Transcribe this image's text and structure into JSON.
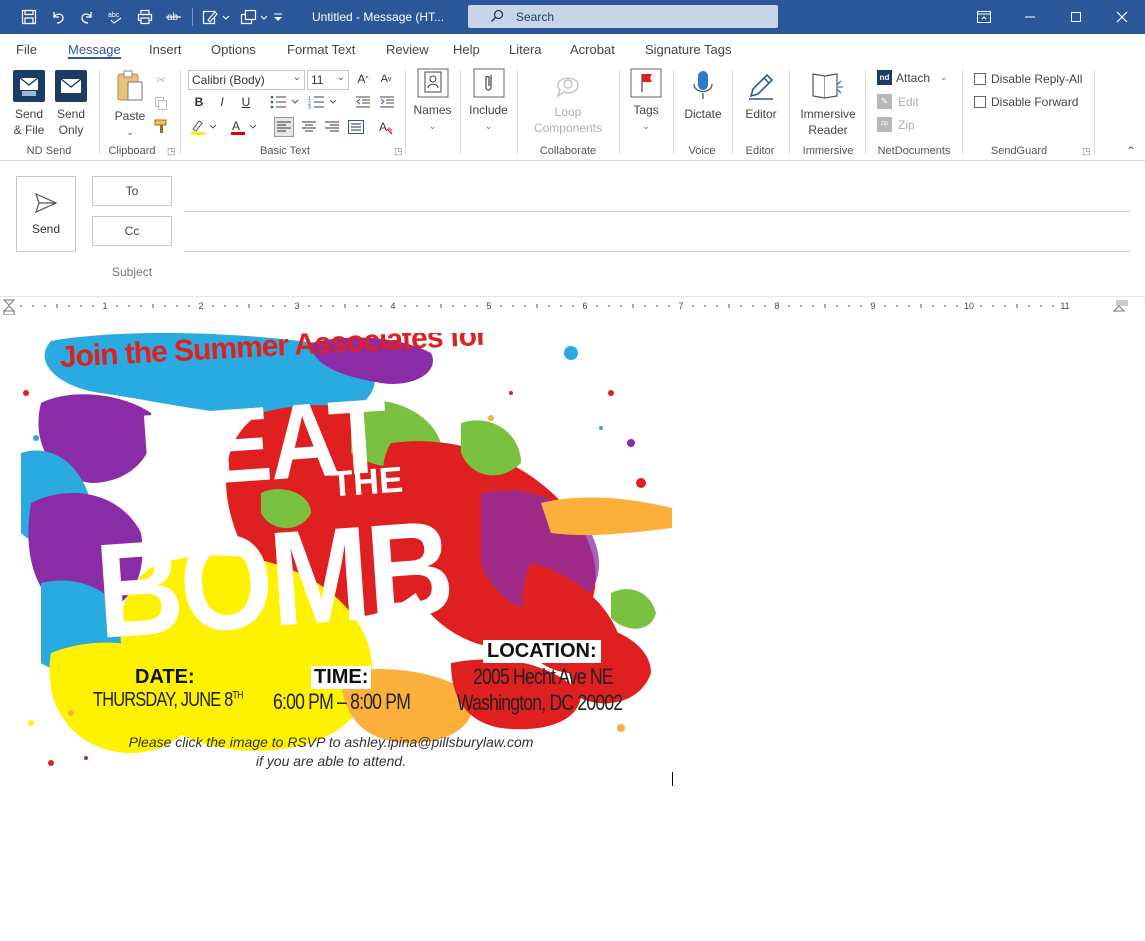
{
  "window": {
    "title": "Untitled  -  Message (HT...",
    "search_placeholder": "Search"
  },
  "ribbon_tabs": [
    "File",
    "Message",
    "Insert",
    "Options",
    "Format Text",
    "Review",
    "Help",
    "Litera",
    "Acrobat",
    "Signature Tags"
  ],
  "active_tab": "Message",
  "ribbon": {
    "nd_send": {
      "label": "ND Send",
      "send_file": "Send\n& File",
      "send_only": "Send\nOnly",
      "send_file_l1": "Send",
      "send_file_l2": "& File",
      "send_only_l1": "Send",
      "send_only_l2": "Only"
    },
    "clipboard": {
      "label": "Clipboard",
      "paste": "Paste"
    },
    "basic_text": {
      "label": "Basic Text",
      "font": "Calibri (Body)",
      "size": "11",
      "bold": "B",
      "italic": "I",
      "underline": "U"
    },
    "names": {
      "label": "Names"
    },
    "include": {
      "label": "Include"
    },
    "collaborate": {
      "label": "Collaborate",
      "loop_l1": "Loop",
      "loop_l2": "Components"
    },
    "tags": {
      "label": "Tags"
    },
    "voice": {
      "label": "Voice",
      "dictate": "Dictate"
    },
    "editor": {
      "label": "Editor",
      "editor": "Editor"
    },
    "immersive": {
      "label": "Immersive",
      "reader_l1": "Immersive",
      "reader_l2": "Reader"
    },
    "netdocuments": {
      "label": "NetDocuments",
      "attach": "Attach",
      "edit": "Edit",
      "zip": "Zip"
    },
    "sendguard": {
      "label": "SendGuard",
      "disable_reply_all": "Disable Reply-All",
      "disable_forward": "Disable Forward"
    }
  },
  "compose": {
    "send": "Send",
    "to": "To",
    "cc": "Cc",
    "subject": "Subject"
  },
  "ruler": {
    "numbers": [
      "1",
      "2",
      "3",
      "4",
      "5",
      "6",
      "7",
      "8",
      "9",
      "10",
      "11"
    ]
  },
  "flyer": {
    "headline": "Join the Summer Associates for",
    "beat": "BEAT",
    "the": "THE",
    "bomb": "BOMB",
    "date_label": "DATE:",
    "date_value": "THURSDAY, JUNE 8",
    "date_sup": "TH",
    "time_label": "TIME:",
    "time_value": "6:00 PM – 8:00 PM",
    "location_label": "LOCATION:",
    "location_line1": "2005 Hecht Ave NE",
    "location_line2": "Washington, DC 20002",
    "rsvp_line1": "Please click the image to RSVP to ashley.ipina@pillsburylaw.com",
    "rsvp_line2": "if you are able to attend."
  },
  "colors": {
    "titlebar": "#2b579a",
    "accent": "#2b579a",
    "headline_red": "#e02020"
  }
}
